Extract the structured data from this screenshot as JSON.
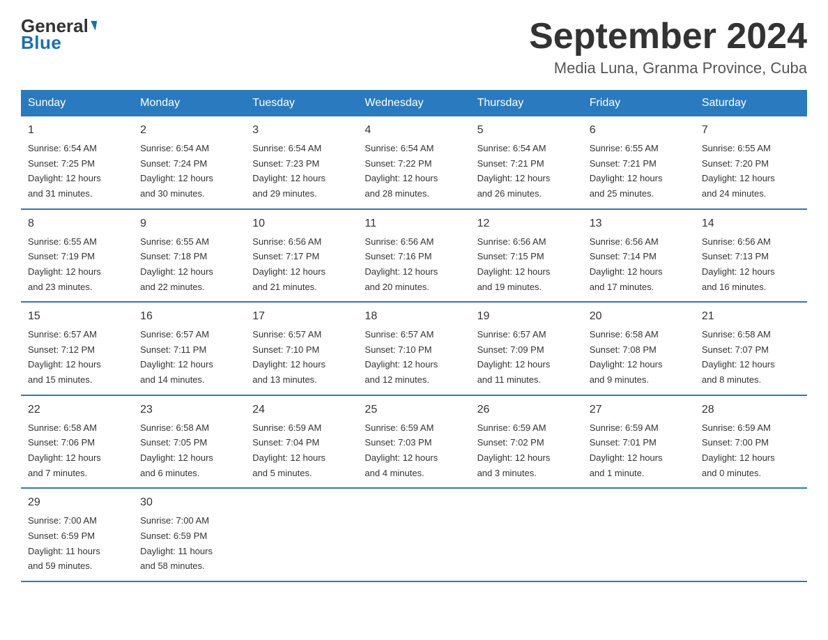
{
  "header": {
    "logo_general": "General",
    "logo_blue": "Blue",
    "month_title": "September 2024",
    "location": "Media Luna, Granma Province, Cuba"
  },
  "days_of_week": [
    "Sunday",
    "Monday",
    "Tuesday",
    "Wednesday",
    "Thursday",
    "Friday",
    "Saturday"
  ],
  "weeks": [
    [
      {
        "num": "1",
        "sunrise": "6:54 AM",
        "sunset": "7:25 PM",
        "daylight": "12 hours and 31 minutes."
      },
      {
        "num": "2",
        "sunrise": "6:54 AM",
        "sunset": "7:24 PM",
        "daylight": "12 hours and 30 minutes."
      },
      {
        "num": "3",
        "sunrise": "6:54 AM",
        "sunset": "7:23 PM",
        "daylight": "12 hours and 29 minutes."
      },
      {
        "num": "4",
        "sunrise": "6:54 AM",
        "sunset": "7:22 PM",
        "daylight": "12 hours and 28 minutes."
      },
      {
        "num": "5",
        "sunrise": "6:54 AM",
        "sunset": "7:21 PM",
        "daylight": "12 hours and 26 minutes."
      },
      {
        "num": "6",
        "sunrise": "6:55 AM",
        "sunset": "7:21 PM",
        "daylight": "12 hours and 25 minutes."
      },
      {
        "num": "7",
        "sunrise": "6:55 AM",
        "sunset": "7:20 PM",
        "daylight": "12 hours and 24 minutes."
      }
    ],
    [
      {
        "num": "8",
        "sunrise": "6:55 AM",
        "sunset": "7:19 PM",
        "daylight": "12 hours and 23 minutes."
      },
      {
        "num": "9",
        "sunrise": "6:55 AM",
        "sunset": "7:18 PM",
        "daylight": "12 hours and 22 minutes."
      },
      {
        "num": "10",
        "sunrise": "6:56 AM",
        "sunset": "7:17 PM",
        "daylight": "12 hours and 21 minutes."
      },
      {
        "num": "11",
        "sunrise": "6:56 AM",
        "sunset": "7:16 PM",
        "daylight": "12 hours and 20 minutes."
      },
      {
        "num": "12",
        "sunrise": "6:56 AM",
        "sunset": "7:15 PM",
        "daylight": "12 hours and 19 minutes."
      },
      {
        "num": "13",
        "sunrise": "6:56 AM",
        "sunset": "7:14 PM",
        "daylight": "12 hours and 17 minutes."
      },
      {
        "num": "14",
        "sunrise": "6:56 AM",
        "sunset": "7:13 PM",
        "daylight": "12 hours and 16 minutes."
      }
    ],
    [
      {
        "num": "15",
        "sunrise": "6:57 AM",
        "sunset": "7:12 PM",
        "daylight": "12 hours and 15 minutes."
      },
      {
        "num": "16",
        "sunrise": "6:57 AM",
        "sunset": "7:11 PM",
        "daylight": "12 hours and 14 minutes."
      },
      {
        "num": "17",
        "sunrise": "6:57 AM",
        "sunset": "7:10 PM",
        "daylight": "12 hours and 13 minutes."
      },
      {
        "num": "18",
        "sunrise": "6:57 AM",
        "sunset": "7:10 PM",
        "daylight": "12 hours and 12 minutes."
      },
      {
        "num": "19",
        "sunrise": "6:57 AM",
        "sunset": "7:09 PM",
        "daylight": "12 hours and 11 minutes."
      },
      {
        "num": "20",
        "sunrise": "6:58 AM",
        "sunset": "7:08 PM",
        "daylight": "12 hours and 9 minutes."
      },
      {
        "num": "21",
        "sunrise": "6:58 AM",
        "sunset": "7:07 PM",
        "daylight": "12 hours and 8 minutes."
      }
    ],
    [
      {
        "num": "22",
        "sunrise": "6:58 AM",
        "sunset": "7:06 PM",
        "daylight": "12 hours and 7 minutes."
      },
      {
        "num": "23",
        "sunrise": "6:58 AM",
        "sunset": "7:05 PM",
        "daylight": "12 hours and 6 minutes."
      },
      {
        "num": "24",
        "sunrise": "6:59 AM",
        "sunset": "7:04 PM",
        "daylight": "12 hours and 5 minutes."
      },
      {
        "num": "25",
        "sunrise": "6:59 AM",
        "sunset": "7:03 PM",
        "daylight": "12 hours and 4 minutes."
      },
      {
        "num": "26",
        "sunrise": "6:59 AM",
        "sunset": "7:02 PM",
        "daylight": "12 hours and 3 minutes."
      },
      {
        "num": "27",
        "sunrise": "6:59 AM",
        "sunset": "7:01 PM",
        "daylight": "12 hours and 1 minute."
      },
      {
        "num": "28",
        "sunrise": "6:59 AM",
        "sunset": "7:00 PM",
        "daylight": "12 hours and 0 minutes."
      }
    ],
    [
      {
        "num": "29",
        "sunrise": "7:00 AM",
        "sunset": "6:59 PM",
        "daylight": "11 hours and 59 minutes."
      },
      {
        "num": "30",
        "sunrise": "7:00 AM",
        "sunset": "6:59 PM",
        "daylight": "11 hours and 58 minutes."
      },
      null,
      null,
      null,
      null,
      null
    ]
  ],
  "labels": {
    "sunrise": "Sunrise:",
    "sunset": "Sunset:",
    "daylight": "Daylight:"
  }
}
